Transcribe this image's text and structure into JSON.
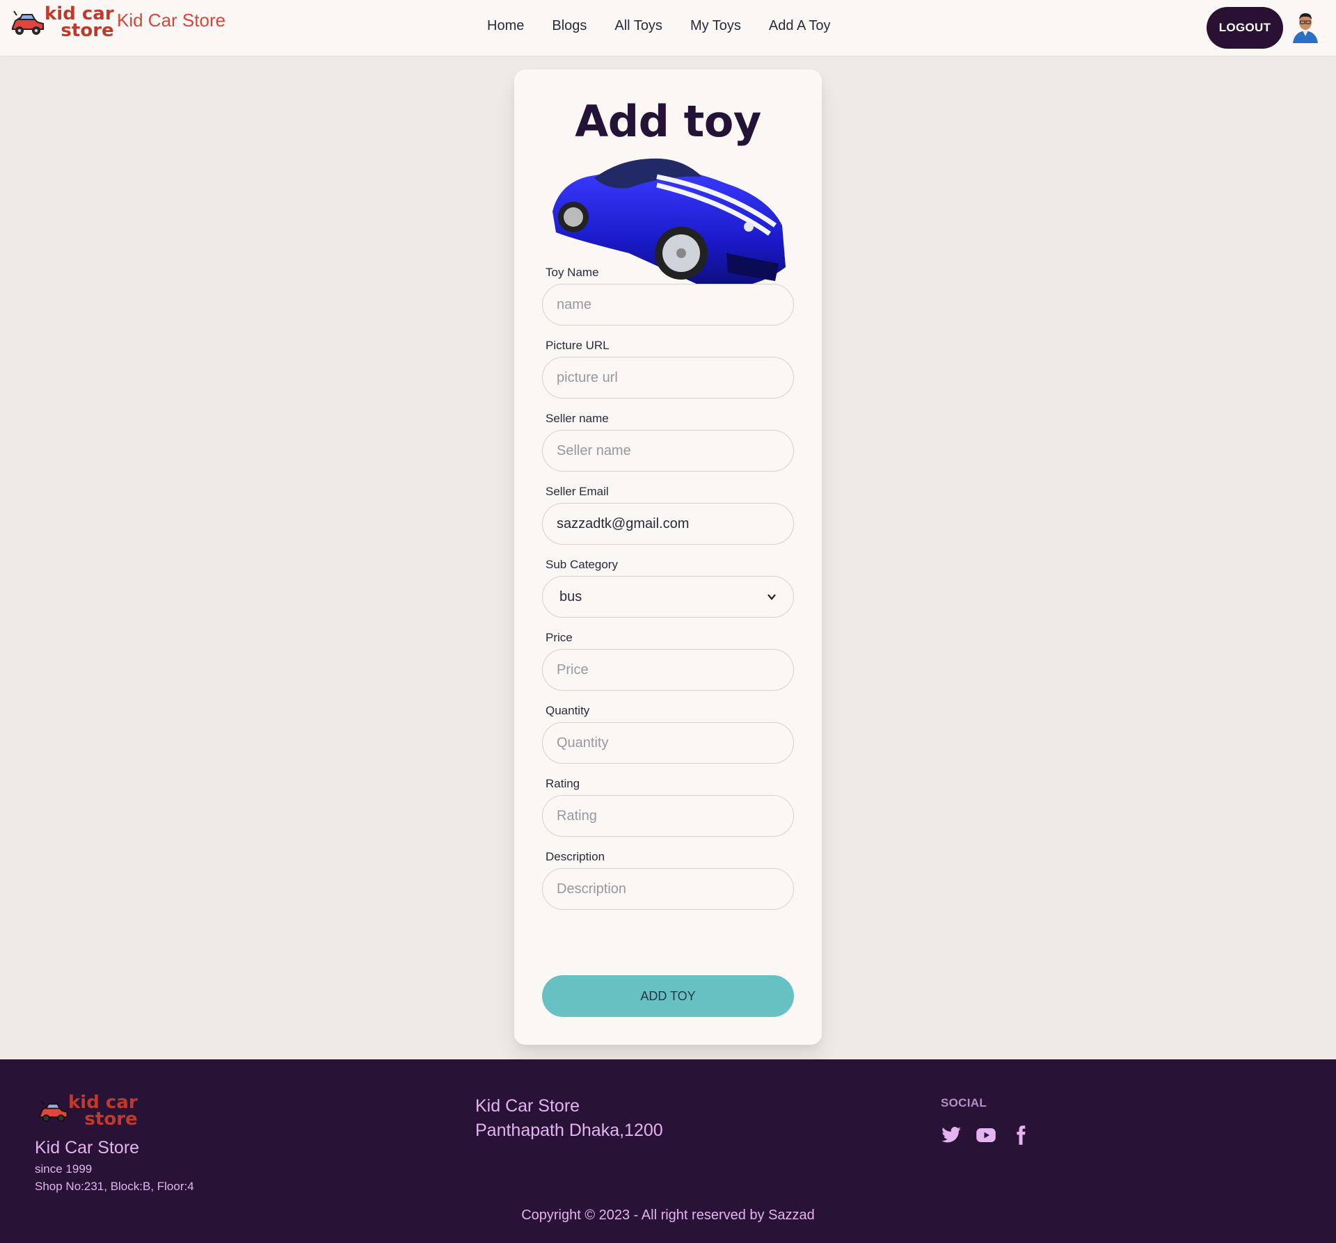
{
  "navbar": {
    "logo_line1": "kid car",
    "logo_line2": "store",
    "brand_name": "Kid Car Store",
    "links": [
      "Home",
      "Blogs",
      "All Toys",
      "My Toys",
      "Add A Toy"
    ],
    "logout_label": "LOGOUT"
  },
  "form": {
    "title": "Add toy",
    "toy_name": {
      "label": "Toy Name",
      "placeholder": "name",
      "value": ""
    },
    "picture_url": {
      "label": "Picture URL",
      "placeholder": "picture url",
      "value": ""
    },
    "seller_name": {
      "label": "Seller name",
      "placeholder": "Seller name",
      "value": ""
    },
    "seller_email": {
      "label": "Seller Email",
      "placeholder": "",
      "value": "sazzadtk@gmail.com"
    },
    "sub_category": {
      "label": "Sub Category",
      "selected": "bus"
    },
    "price": {
      "label": "Price",
      "placeholder": "Price",
      "value": ""
    },
    "quantity": {
      "label": "Quantity",
      "placeholder": "Quantity",
      "value": ""
    },
    "rating": {
      "label": "Rating",
      "placeholder": "Rating",
      "value": ""
    },
    "description": {
      "label": "Description",
      "placeholder": "Description",
      "value": ""
    },
    "submit_label": "ADD TOY"
  },
  "footer": {
    "logo_line1": "kid car",
    "logo_line2": "store",
    "brand_name": "Kid Car Store",
    "since": "since 1999",
    "address_line": "Shop No:231, Block:B, Floor:4",
    "store_name": "Kid Car Store",
    "store_address": "Panthapath Dhaka,1200",
    "social_title": "SOCIAL",
    "social_icons": [
      "twitter-icon",
      "youtube-icon",
      "facebook-icon"
    ],
    "copyright": "Copyright © 2023 - All right reserved by Sazzad"
  },
  "colors": {
    "accent_red": "#d9453a",
    "dark_purple": "#281236",
    "teal_button": "#67c1c3",
    "footer_text": "#e4b4f0"
  }
}
